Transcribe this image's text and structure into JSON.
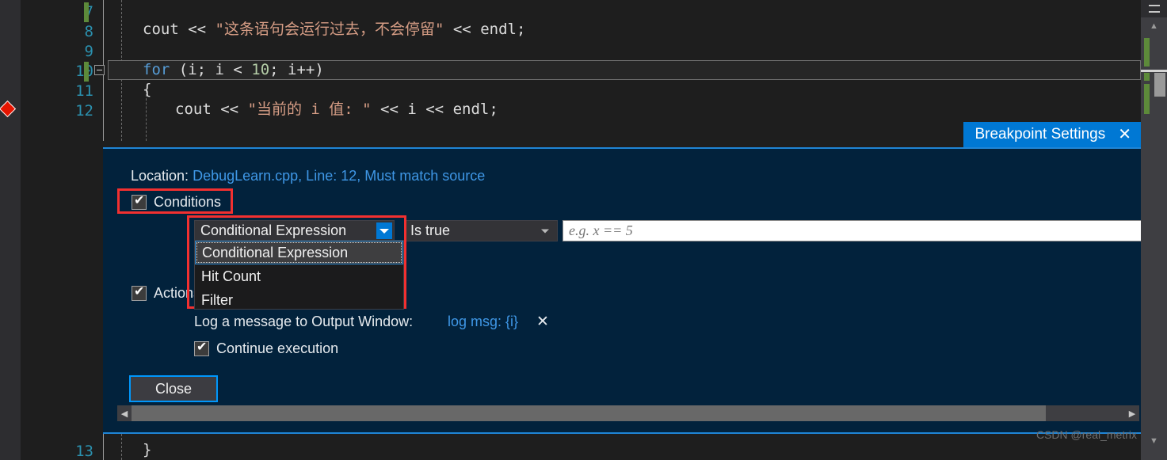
{
  "editor": {
    "line_numbers": [
      "7",
      "8",
      "9",
      "10",
      "11",
      "12",
      "13"
    ],
    "lines": [
      {
        "number": "7",
        "text": ""
      },
      {
        "number": "8",
        "text": "cout << \"这条语句会运行过去，不会停留\" << endl;"
      },
      {
        "number": "9",
        "text": ""
      },
      {
        "number": "10",
        "text": "for (i; i < 10; i++)"
      },
      {
        "number": "11",
        "text": "{"
      },
      {
        "number": "12",
        "text": "cout << \"当前的 i 值: \" << i << endl;"
      },
      {
        "number": "13",
        "text": "}"
      }
    ],
    "line8": {
      "code": "cout",
      "op1": " << ",
      "string": "\"这条语句会运行过去，不会停留\"",
      "op2": " << ",
      "end": "endl;"
    },
    "line10": {
      "kw": "for",
      "rest": " (i; i < ",
      "num": "10",
      "tail": "; i++)"
    },
    "line11": {
      "text": "{"
    },
    "line12": {
      "code": "cout",
      "op1": " << ",
      "string": "\"当前的 i 值: \"",
      "op2": " << i << ",
      "end": "endl;"
    },
    "line13": {
      "text": "}"
    },
    "glyphs": {
      "breakpoint": "conditional-breakpoint-diamond",
      "collapse": "collapse-minus-box"
    }
  },
  "peek": {
    "tab_title": "Breakpoint Settings",
    "close_glyph": "✕",
    "location_label": "Location:",
    "location_value": "DebugLearn.cpp, Line: 12, Must match source",
    "conditions": {
      "label": "Conditions",
      "checked": true,
      "condition_type_value": "Conditional Expression",
      "comparison_value": "Is true",
      "expression_placeholder": "e.g. x == 5",
      "expression_value": "",
      "dropdown_options": [
        "Conditional Expression",
        "Hit Count",
        "Filter"
      ],
      "dropdown_selected": "Conditional Expression"
    },
    "actions": {
      "label": "Actions",
      "checked": true,
      "log_label": "Log a message to Output Window:",
      "log_message": "log msg: {i}",
      "log_remove_glyph": "✕",
      "continue_label": "Continue execution",
      "continue_checked": true
    },
    "close_button_label": "Close",
    "scrollbar": {
      "left_arrow": "◀",
      "right_arrow": "▶"
    }
  },
  "watermark": "CSDN @real_metrix",
  "colors": {
    "accent_blue": "#0078d4",
    "panel_bg": "#02223c",
    "link_blue": "#3f97e6",
    "annotation_red": "#f23030",
    "breakpoint_red": "#e51400",
    "keyword_blue": "#569cd6",
    "string_orange": "#d69d85",
    "number_green": "#b5cea8",
    "lineno_cyan": "#2b91af",
    "changebar_green": "#5d8a3a"
  }
}
